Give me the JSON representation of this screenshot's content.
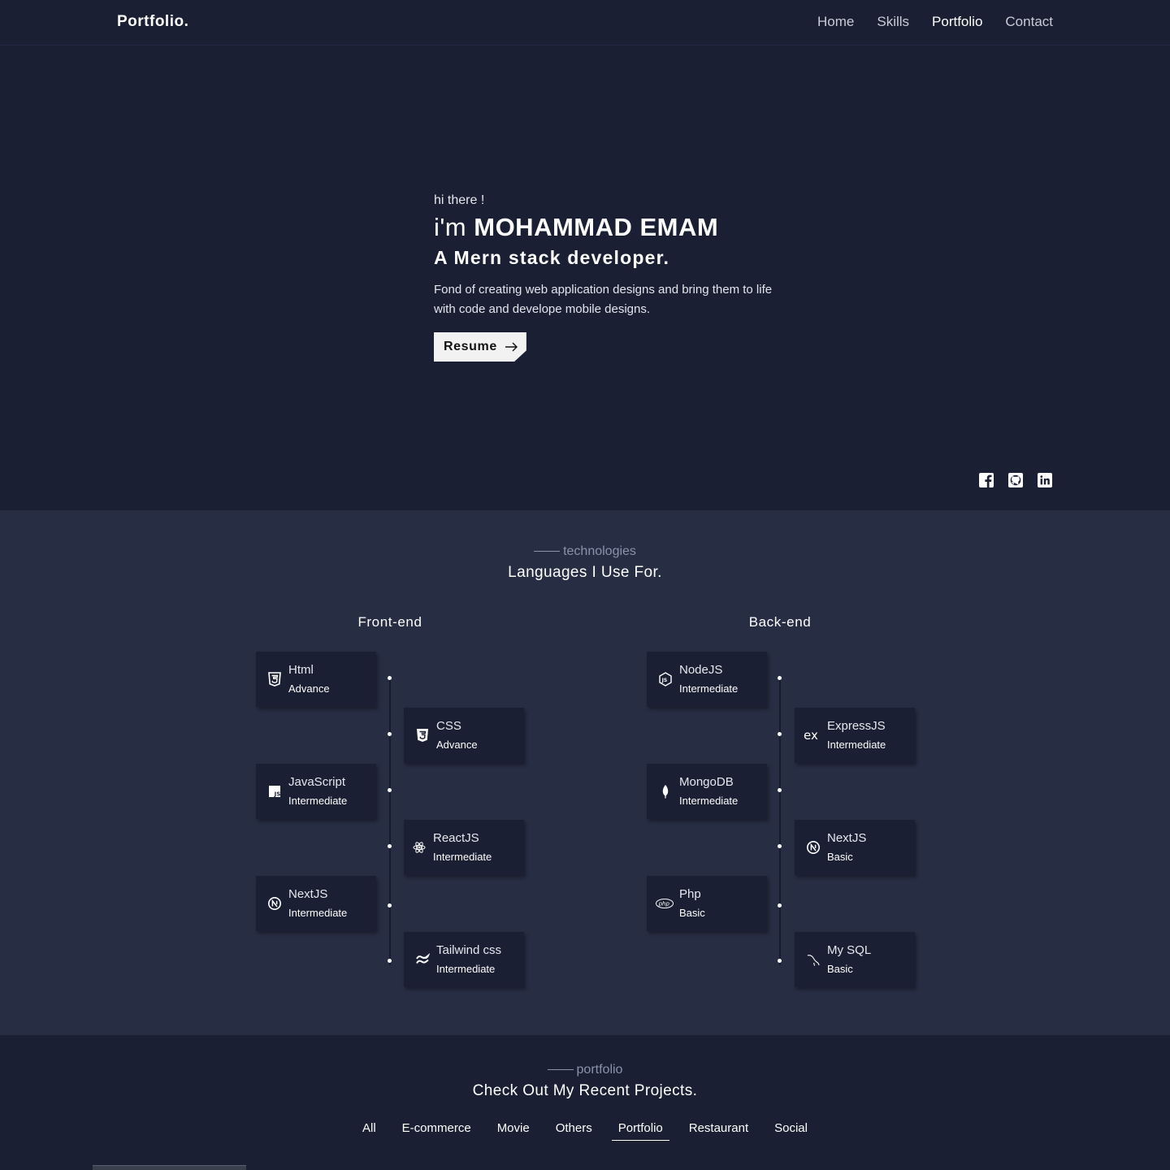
{
  "brand": "Portfolio.",
  "nav": [
    {
      "label": "Home",
      "active": false
    },
    {
      "label": "Skills",
      "active": false
    },
    {
      "label": "Portfolio",
      "active": true
    },
    {
      "label": "Contact",
      "active": false
    }
  ],
  "hero": {
    "greeting": "hi there !",
    "name_prefix": "i'm ",
    "name": "MOHAMMAD EMAM",
    "role": "A Mern stack developer.",
    "intro": "Fond of creating web application designs and bring them to life with code and develope mobile designs.",
    "resume_label": "Resume",
    "socials": [
      {
        "name": "facebook-icon"
      },
      {
        "name": "github-icon"
      },
      {
        "name": "linkedin-icon"
      }
    ]
  },
  "technologies": {
    "eyebrow": "technologies",
    "title": "Languages I Use For.",
    "frontend": {
      "title": "Front-end",
      "items": [
        {
          "name": "Html",
          "level": "Advance",
          "icon": "html5-icon"
        },
        {
          "name": "CSS",
          "level": "Advance",
          "icon": "css3-icon"
        },
        {
          "name": "JavaScript",
          "level": "Intermediate",
          "icon": "javascript-icon"
        },
        {
          "name": "ReactJS",
          "level": "Intermediate",
          "icon": "react-icon"
        },
        {
          "name": "NextJS",
          "level": "Intermediate",
          "icon": "nextjs-icon"
        },
        {
          "name": "Tailwind css",
          "level": "Intermediate",
          "icon": "tailwind-icon"
        }
      ]
    },
    "backend": {
      "title": "Back-end",
      "items": [
        {
          "name": "NodeJS",
          "level": "Intermediate",
          "icon": "nodejs-icon"
        },
        {
          "name": "ExpressJS",
          "level": "Intermediate",
          "icon": "express-icon"
        },
        {
          "name": "MongoDB",
          "level": "Intermediate",
          "icon": "mongodb-icon"
        },
        {
          "name": "NextJS",
          "level": "Basic",
          "icon": "nextjs-icon"
        },
        {
          "name": "Php",
          "level": "Basic",
          "icon": "php-icon"
        },
        {
          "name": "My SQL",
          "level": "Basic",
          "icon": "mysql-icon"
        }
      ]
    }
  },
  "portfolio": {
    "eyebrow": "portfolio",
    "title": "Check Out My Recent Projects.",
    "filters": [
      {
        "label": "All",
        "active": false
      },
      {
        "label": "E-commerce",
        "active": false
      },
      {
        "label": "Movie",
        "active": false
      },
      {
        "label": "Others",
        "active": false
      },
      {
        "label": "Portfolio",
        "active": true
      },
      {
        "label": "Restaurant",
        "active": false
      },
      {
        "label": "Social",
        "active": false
      }
    ]
  }
}
